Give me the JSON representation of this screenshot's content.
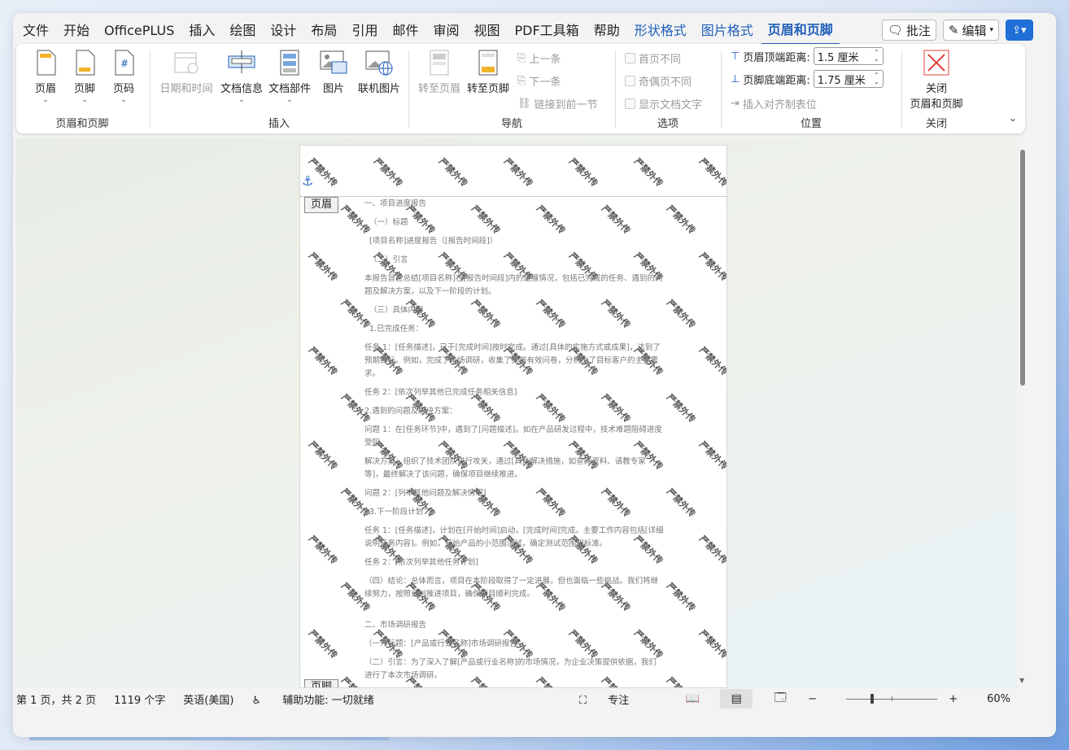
{
  "menu": {
    "tabs": [
      "文件",
      "开始",
      "OfficePLUS",
      "插入",
      "绘图",
      "设计",
      "布局",
      "引用",
      "邮件",
      "审阅",
      "视图",
      "PDF工具箱",
      "帮助"
    ],
    "context_tabs": [
      "形状格式",
      "图片格式"
    ],
    "active_tab": "页眉和页脚",
    "comment_label": "批注",
    "edit_label": "编辑"
  },
  "ribbon": {
    "group1": {
      "label": "页眉和页脚",
      "header": "页眉",
      "footer": "页脚",
      "page_number": "页码"
    },
    "group2": {
      "label": "插入",
      "date_time": "日期和时间",
      "doc_info": "文档信息",
      "doc_parts": "文档部件",
      "picture": "图片",
      "online_picture": "联机图片"
    },
    "group3": {
      "label": "导航",
      "goto_header": "转至页眉",
      "goto_footer": "转至页脚",
      "previous": "上一条",
      "next": "下一条",
      "link_previous": "链接到前一节"
    },
    "group4": {
      "label": "选项",
      "first_page_diff": "首页不同",
      "odd_even_diff": "奇偶页不同",
      "show_doc_text": "显示文档文字"
    },
    "group5": {
      "label": "位置",
      "header_top_label": "页眉顶端距离:",
      "header_top_value": "1.5 厘米",
      "footer_bottom_label": "页脚底端距离:",
      "footer_bottom_value": "1.75 厘米",
      "insert_align_tab": "插入对齐制表位"
    },
    "group6": {
      "label": "关闭",
      "close_line1": "关闭",
      "close_line2": "页眉和页脚"
    }
  },
  "page": {
    "header_tag": "页眉",
    "footer_tag": "页脚",
    "watermark_text": "严禁外传",
    "paragraphs": [
      "一、项目进度报告",
      "（一）标题",
      "[项目名称]进度报告（[报告时间段]）",
      "（二）引言",
      "本报告旨在总结[项目名称]在[报告时间段]内的进展情况，包括已完成的任务、遇到的问题及解决方案，以及下一阶段的计划。",
      "（三）具体内容",
      "1.已完成任务：",
      "任务 1：[任务描述]，已于[完成时间]按时完成。通过[具体的实施方式或成果]，达到了预期目标。例如，完成了市场调研，收集了大量有效问卷，分析出了目标客户的主要需求。",
      "任务 2：[依次列举其他已完成任务相关信息]",
      "2.遇到的问题及解决方案：",
      "问题 1：在[任务环节]中，遇到了[问题描述]。如在产品研发过程中，技术难题阻碍进度受阻。",
      "解决方案：组织了技术团队进行攻关，通过[具体解决措施，如查阅资料、请教专家等]，最终解决了该问题，确保项目继续推进。",
      "问题 2：[列举其他问题及解决情况]",
      "3.下一阶段计划：",
      "任务 1：[任务描述]，计划在[开始时间]启动，[完成时间]完成。主要工作内容包括[详细说明任务内容]。例如，开始产品的小范围测试，确定测试范围和标准。",
      "任务 2：[依次列举其他任务计划]",
      "（四）结论：总体而言，项目在本阶段取得了一定进展，但也面临一些挑战。我们将继续努力，按照计划推进项目，确保项目顺利完成。",
      "二、市场调研报告",
      "（一）标题：[产品或行业名称]市场调研报告",
      "（二）引言：为了深入了解[产品或行业名称]的市场情况，为企业决策提供依据，我们进行了本次市场调研。"
    ]
  },
  "status": {
    "page_info": "第 1 页，共 2 页",
    "word_count": "1119 个字",
    "language": "英语(美国)",
    "accessibility": "辅助功能: 一切就绪",
    "focus": "专注",
    "zoom": "60%",
    "zoom_minus": "−",
    "zoom_plus": "+"
  },
  "colors": {
    "accent": "#1f5fb8",
    "close_red": "#e0403a",
    "share_blue": "#1f6fd6"
  }
}
